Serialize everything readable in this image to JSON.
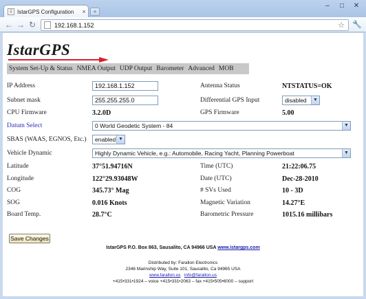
{
  "browser": {
    "tab_title": "IstarGPS Configuration",
    "tab_close": "×",
    "new_tab": "+",
    "window_buttons": [
      "–",
      "□",
      "✕"
    ],
    "url": "192.168.1.152",
    "nav": {
      "back": "←",
      "forward": "→",
      "reload": "↻"
    }
  },
  "logo": {
    "text": "IstarGPS"
  },
  "menu": {
    "items": [
      "System Set-Up & Status",
      "NMEA Output",
      "UDP Output",
      "Barometer",
      "Advanced",
      "MOB"
    ]
  },
  "form": {
    "ip_label": "IP Address",
    "ip_value": "192.168.1.152",
    "subnet_label": "Subnet mask",
    "subnet_value": "255.255.255.0",
    "cpu_label": "CPU Firmware",
    "cpu_value": "3.2.0D",
    "antenna_label": "Antenna Status",
    "antenna_value": "NTSTATUS=OK",
    "diff_label": "Differential GPS Input",
    "diff_value": "disabled",
    "gps_fw_label": "GPS Firmware",
    "gps_fw_value": "5.00",
    "datum_label": "Datum Select",
    "datum_value": "0 World Geodetic System - 84",
    "sbas_label": "SBAS (WAAS, EGNOS, Etc.)",
    "sbas_value": "enabled",
    "vehicle_label": "Vehicle Dynamic",
    "vehicle_value": "Highly Dynamic Vehicle, e.g.: Automobile, Racing Yacht, Planning Powerboat"
  },
  "status": {
    "latitude_label": "Latitude",
    "latitude_value": "37°51.94716N",
    "longitude_label": "Longitude",
    "longitude_value": "122°29.93048W",
    "cog_label": "COG",
    "cog_value": "345.73° Mag",
    "sog_label": "SOG",
    "sog_value": "0.016 Knots",
    "board_label": "Board Temp.",
    "board_value": "28.7°C",
    "time_label": "Time (UTC)",
    "time_value": "21:22:06.75",
    "date_label": "Date (UTC)",
    "date_value": "Dec-28-2010",
    "svs_label": "# SVs Used",
    "svs_value": "10 - 3D",
    "magvar_label": "Magnetic Variation",
    "magvar_value": "14.27°E",
    "baro_label": "Barometric Pressure",
    "baro_value": "1015.16 millibars"
  },
  "save_button": "Save Changes",
  "footer": {
    "address": "IstarGPS P.O. Box 863, Sausalito, CA 94966 USA",
    "site_link": "www.istargps.com",
    "distributed": "Distributed by: Farallon Electronics",
    "dist_address": "2346 Marinship Way, Suite 101, Sausalito, Ca 94965 USA",
    "dist_link": "www.farallon.us",
    "dist_email": "info@farallon.us",
    "phones": "+415•331•1924 – voice +415•331•2063 – fax +415•505•6000 – support"
  },
  "colors": {
    "logo_arrow": "#d8202a",
    "link": "#2a2ab4",
    "menu_bg": "#c8c8c8"
  }
}
